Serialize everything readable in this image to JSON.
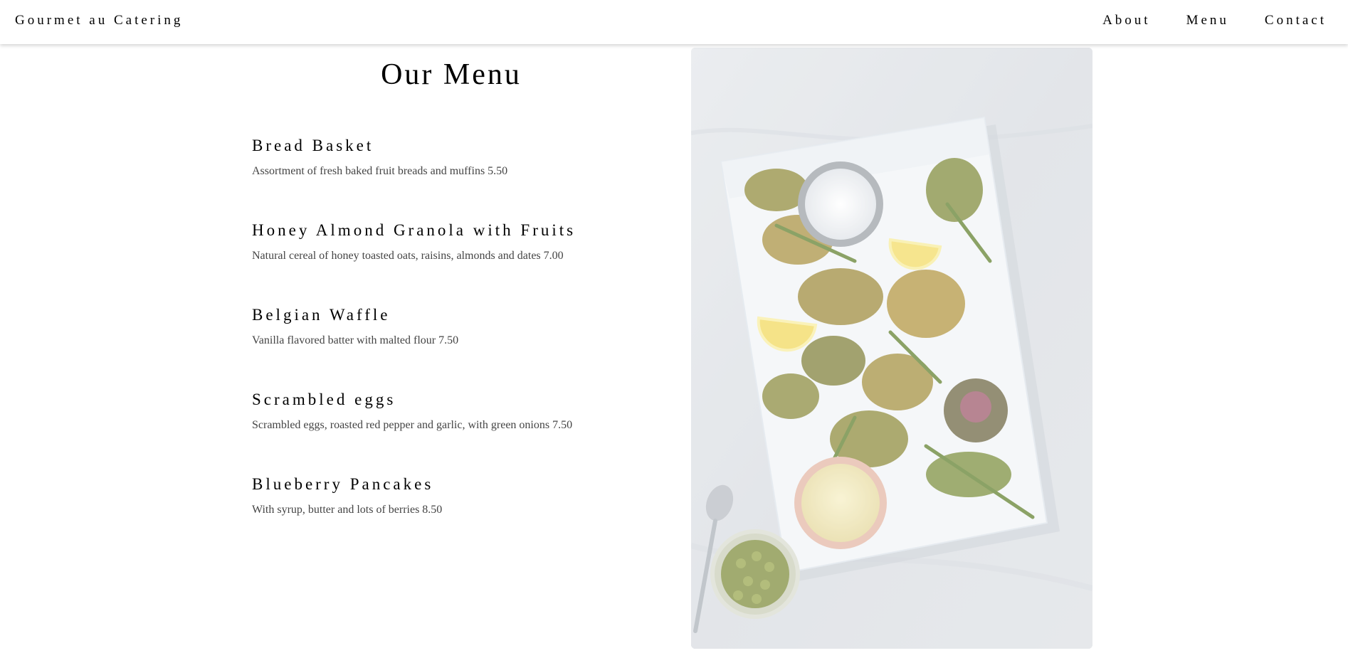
{
  "header": {
    "brand": "Gourmet au Catering",
    "nav": [
      "About",
      "Menu",
      "Contact"
    ]
  },
  "main": {
    "title": "Our Menu",
    "items": [
      {
        "name": "Bread Basket",
        "description": "Assortment of fresh baked fruit breads and muffins 5.50"
      },
      {
        "name": "Honey Almond Granola with Fruits",
        "description": "Natural cereal of honey toasted oats, raisins, almonds and dates 7.00"
      },
      {
        "name": "Belgian Waffle",
        "description": "Vanilla flavored batter with malted flour 7.50"
      },
      {
        "name": "Scrambled eggs",
        "description": "Scrambled eggs, roasted red pepper and garlic, with green onions 7.50"
      },
      {
        "name": "Blueberry Pancakes",
        "description": "With syrup, butter and lots of berries 8.50"
      }
    ]
  },
  "photo": {
    "subject": "fried vegetables on a board with salt, lemon, mayonnaise and capers"
  }
}
